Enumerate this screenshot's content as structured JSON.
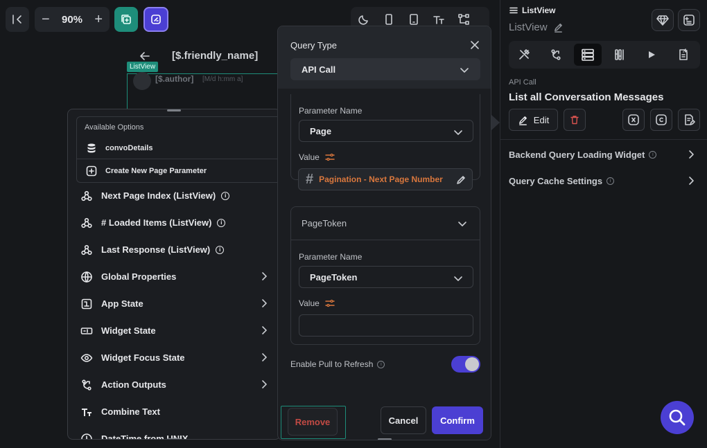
{
  "toolbar": {
    "zoom": "90%",
    "zoom_minus": "−",
    "zoom_plus": "+"
  },
  "canvas": {
    "page_title": "[$.friendly_name]",
    "listview_tag": "ListView",
    "author": "[$.author]",
    "timestamp": "[M/d h:mm a]"
  },
  "options": {
    "header": "Available Options",
    "source": "convoDetails",
    "create": "Create New Page Parameter",
    "items": [
      {
        "label": "Next Page Index (ListView)",
        "info": true,
        "chevron": false
      },
      {
        "label": "# Loaded Items (ListView)",
        "info": true,
        "chevron": false
      },
      {
        "label": "Last Response (ListView)",
        "info": true,
        "chevron": false
      },
      {
        "label": "Global Properties",
        "info": false,
        "chevron": true
      },
      {
        "label": "App State",
        "info": false,
        "chevron": true
      },
      {
        "label": "Widget State",
        "info": false,
        "chevron": true
      },
      {
        "label": "Widget Focus State",
        "info": false,
        "chevron": true
      },
      {
        "label": "Action Outputs",
        "info": false,
        "chevron": true
      },
      {
        "label": "Combine Text",
        "info": false,
        "chevron": false
      },
      {
        "label": "DateTime from UNIX",
        "info": false,
        "chevron": false
      }
    ]
  },
  "dialog": {
    "query_type_label": "Query Type",
    "query_type_value": "API Call",
    "param1": {
      "name_label": "Parameter Name",
      "name_value": "Page",
      "value_label": "Value",
      "value_text": "Pagination - Next Page Number"
    },
    "param2": {
      "header": "PageToken",
      "name_label": "Parameter Name",
      "name_value": "PageToken",
      "value_label": "Value",
      "value_text": ""
    },
    "pull_to_refresh": "Enable Pull to Refresh",
    "remove": "Remove",
    "cancel": "Cancel",
    "confirm": "Confirm"
  },
  "right_panel": {
    "title": "ListView",
    "subtitle": "ListView",
    "api_small": "API Call",
    "api_name": "List all Conversation Messages",
    "edit": "Edit",
    "rows": [
      "Backend Query Loading Widget",
      "Query Cache Settings"
    ]
  },
  "colors": {
    "accent": "#4b3fd3",
    "teal": "#1e8d7a",
    "orange": "#d9773d",
    "danger": "#d9534f"
  }
}
